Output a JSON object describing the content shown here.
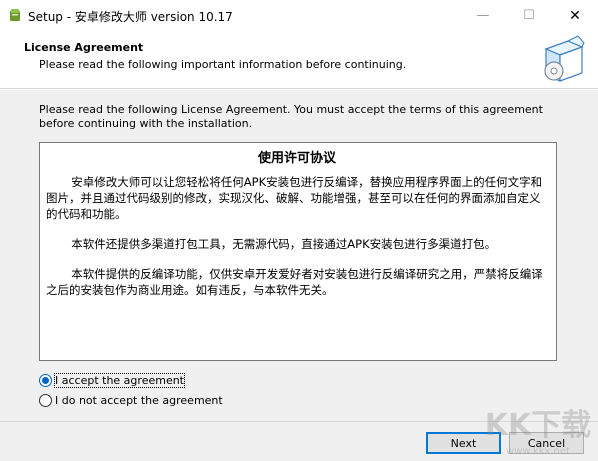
{
  "window": {
    "title": "Setup - 安卓修改大师 version 10.17",
    "controls": {
      "minimize": "—",
      "maximize": "☐",
      "close": "✕"
    }
  },
  "header": {
    "title": "License Agreement",
    "subtitle": "Please read the following important information before continuing."
  },
  "main": {
    "intro": "Please read the following License Agreement. You must accept the terms of this agreement before continuing with the installation.",
    "license": {
      "title": "使用许可协议",
      "paragraphs": [
        "安卓修改大师可以让您轻松将任何APK安装包进行反编译，替换应用程序界面上的任何文字和图片，并且通过代码级别的修改，实现汉化、破解、功能增强，甚至可以在任何的界面添加自定义的代码和功能。",
        "本软件还提供多渠道打包工具，无需源代码，直接通过APK安装包进行多渠道打包。",
        "本软件提供的反编译功能，仅供安卓开发爱好者对安装包进行反编译研究之用，严禁将反编译之后的安装包作为商业用途。如有违反，与本软件无关。"
      ]
    },
    "options": {
      "accept": "I accept the agreement",
      "decline": "I do not accept the agreement",
      "selected": "accept"
    }
  },
  "footer": {
    "next": "Next",
    "cancel": "Cancel"
  },
  "watermark": {
    "text": "KK下载",
    "url": "www.kkx.net"
  },
  "colors": {
    "accent": "#0078d7",
    "panel": "#f0f0f0"
  }
}
